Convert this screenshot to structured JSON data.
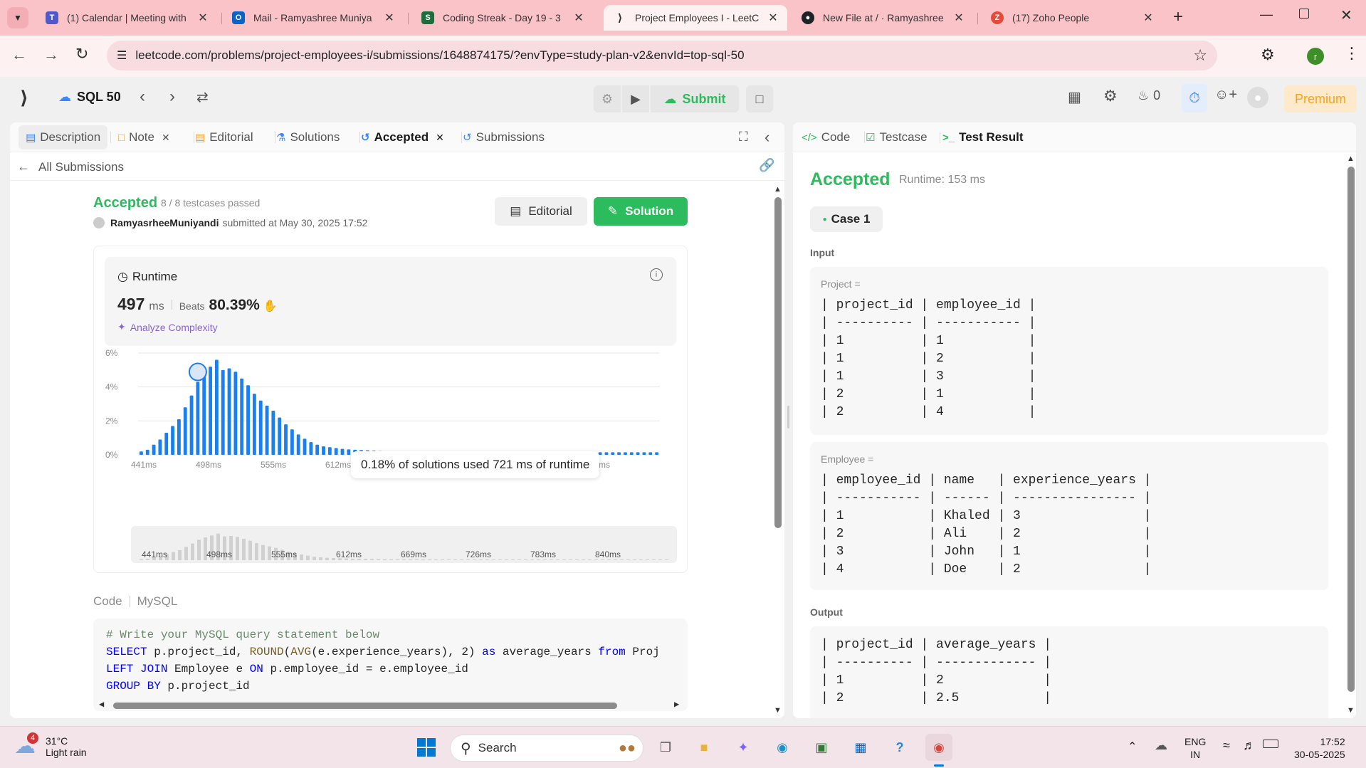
{
  "browser": {
    "tabs": [
      {
        "title": "(1) Calendar | Meeting with",
        "favicon_color": "#5059c9"
      },
      {
        "title": "Mail - Ramyashree Muniya",
        "favicon_color": "#0a64c8"
      },
      {
        "title": "Coding Streak - Day 19 - 3",
        "favicon_color": "#1b6f3a"
      },
      {
        "title": "Project Employees I - LeetC",
        "favicon_color": "#ffa116"
      },
      {
        "title": "New File at / · Ramyashree",
        "favicon_color": "#1f2328"
      },
      {
        "title": "(17) Zoho People",
        "favicon_color": "#e44b3b"
      }
    ],
    "url": "leetcode.com/problems/project-employees-i/submissions/1648874175/?envType=study-plan-v2&envId=top-sql-50",
    "profile_initial": "r"
  },
  "header": {
    "study_plan": "SQL 50",
    "submit_label": "Submit",
    "streak_count": "0",
    "premium_label": "Premium"
  },
  "left": {
    "tabs": [
      "Description",
      "Note",
      "Editorial",
      "Solutions",
      "Accepted",
      "Submissions"
    ],
    "back_label": "All Submissions",
    "status": "Accepted",
    "testcases": "8 / 8 testcases passed",
    "username": "RamyasrheeMuniyandi",
    "submitted_text": "submitted at May 30, 2025 17:52",
    "editorial_btn": "Editorial",
    "solution_btn": "Solution",
    "runtime_title": "Runtime",
    "runtime_value": "497",
    "runtime_unit": "ms",
    "beats_label": "Beats",
    "beats_value": "80.39%",
    "analyze_label": "Analyze Complexity",
    "tooltip": "0.18% of solutions used 721 ms of runtime",
    "code_label": "Code",
    "lang_label": "MySQL",
    "code_lines": [
      "# Write your MySQL query statement below",
      "SELECT p.project_id, ROUND(AVG(e.experience_years), 2) as average_years from Proj",
      "LEFT JOIN Employee e ON p.employee_id = e.employee_id",
      "GROUP BY p.project_id"
    ]
  },
  "chart_data": {
    "type": "bar",
    "title": "Runtime",
    "xlabel": "",
    "ylabel": "",
    "y_ticks": [
      "6%",
      "4%",
      "2%",
      "0%"
    ],
    "x_ticks": [
      "441ms",
      "498ms",
      "555ms",
      "612ms",
      "669ms",
      "726ms",
      "783ms",
      "840ms"
    ],
    "ylim": [
      0,
      6
    ],
    "grid": true,
    "user_runtime": "497ms",
    "values": [
      0.2,
      0.3,
      0.6,
      0.9,
      1.3,
      1.7,
      2.1,
      2.8,
      3.5,
      4.3,
      4.8,
      5.2,
      5.6,
      5.0,
      5.1,
      4.9,
      4.5,
      4.1,
      3.6,
      3.2,
      2.9,
      2.6,
      2.2,
      1.8,
      1.5,
      1.2,
      0.95,
      0.75,
      0.6,
      0.5,
      0.45,
      0.4,
      0.35,
      0.32,
      0.3,
      0.28,
      0.26,
      0.24,
      0.22,
      0.21,
      0.2,
      0.19,
      0.18,
      0.18,
      0.17,
      0.17,
      0.16,
      0.16,
      0.16,
      0.15,
      0.15,
      0.15,
      0.15,
      0.15,
      0.15,
      0.15,
      0.15,
      0.15,
      0.15,
      0.15,
      0.15,
      0.15,
      0.15,
      0.15,
      0.15,
      0.15,
      0.15,
      0.15,
      0.15,
      0.15,
      0.15,
      0.15,
      0.15,
      0.15,
      0.15,
      0.15,
      0.15,
      0.15,
      0.15,
      0.15,
      0.15,
      0.15,
      0.15
    ],
    "highlight_index": 9
  },
  "right": {
    "tabs": [
      "Code",
      "Testcase",
      "Test Result"
    ],
    "status": "Accepted",
    "runtime": "Runtime: 153 ms",
    "case_label": "Case 1",
    "input_label": "Input",
    "output_label": "Output",
    "project_label": "Project =",
    "project_table": [
      "| project_id | employee_id |",
      "| ---------- | ----------- |",
      "| 1          | 1           |",
      "| 1          | 2           |",
      "| 1          | 3           |",
      "| 2          | 1           |",
      "| 2          | 4           |"
    ],
    "employee_label": "Employee =",
    "employee_table": [
      "| employee_id | name   | experience_years |",
      "| ----------- | ------ | ---------------- |",
      "| 1           | Khaled | 3                |",
      "| 2           | Ali    | 2                |",
      "| 3           | John   | 1                |",
      "| 4           | Doe    | 2                |"
    ],
    "output_table": [
      "| project_id | average_years |",
      "| ---------- | ------------- |",
      "| 1          | 2             |",
      "| 2          | 2.5           |"
    ]
  },
  "taskbar": {
    "weather_temp": "31°C",
    "weather_desc": "Light rain",
    "weather_badge": "4",
    "search_placeholder": "Search",
    "lang1": "ENG",
    "lang2": "IN",
    "time": "17:52",
    "date": "30-05-2025"
  }
}
